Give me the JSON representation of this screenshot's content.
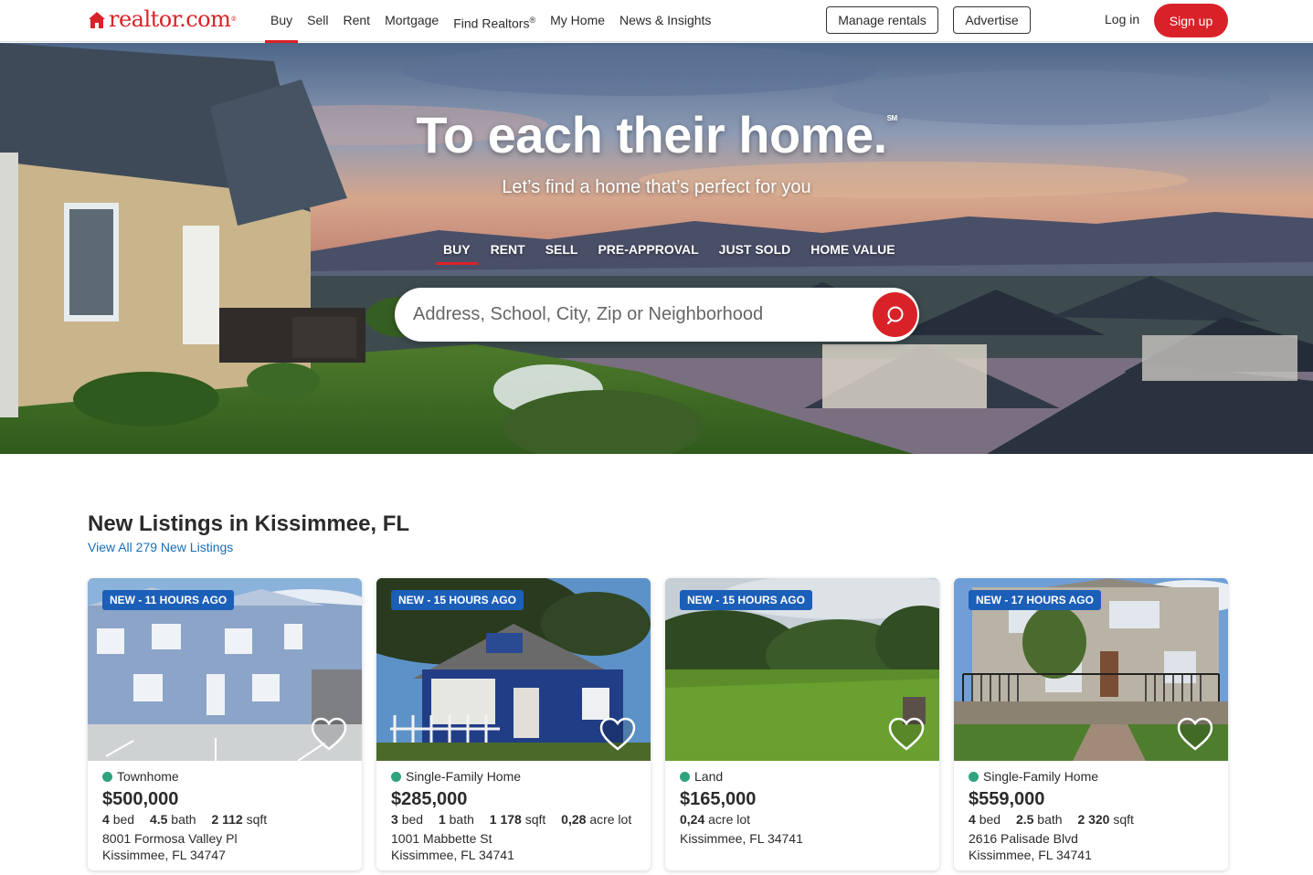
{
  "header": {
    "logo_text": "realtor.com",
    "logo_mark": "®",
    "nav": [
      {
        "label": "Buy",
        "active": true
      },
      {
        "label": "Sell"
      },
      {
        "label": "Rent"
      },
      {
        "label": "Mortgage"
      },
      {
        "label": "Find Realtors",
        "sup": "®"
      },
      {
        "label": "My Home"
      },
      {
        "label": "News & Insights"
      }
    ],
    "manage_rentals": "Manage rentals",
    "advertise": "Advertise",
    "login": "Log in",
    "signup": "Sign up"
  },
  "hero": {
    "title": "To each their home.",
    "title_mark": "SM",
    "subtitle": "Let’s find a home that’s perfect for you",
    "tabs": [
      "BUY",
      "RENT",
      "SELL",
      "PRE-APPROVAL",
      "JUST SOLD",
      "HOME VALUE"
    ],
    "active_tab": "BUY",
    "search_placeholder": "Address, School, City, Zip or Neighborhood"
  },
  "listings": {
    "title": "New Listings in Kissimmee, FL",
    "view_all": "View All 279 New Listings",
    "cards": [
      {
        "badge": "NEW - 11 HOURS AGO",
        "type": "Townhome",
        "price": "$500,000",
        "beds": "4",
        "beds_label": "bed",
        "baths": "4.5",
        "baths_label": "bath",
        "sqft": "2 112",
        "sqft_label": "sqft",
        "lot": "",
        "lot_label": "",
        "address1": "8001 Formosa Valley Pl",
        "address2": "Kissimmee, FL 34747"
      },
      {
        "badge": "NEW - 15 HOURS AGO",
        "type": "Single-Family Home",
        "price": "$285,000",
        "beds": "3",
        "beds_label": "bed",
        "baths": "1",
        "baths_label": "bath",
        "sqft": "1 178",
        "sqft_label": "sqft",
        "lot": "0,28",
        "lot_label": "acre lot",
        "address1": "1001 Mabbette St",
        "address2": "Kissimmee, FL 34741"
      },
      {
        "badge": "NEW - 15 HOURS AGO",
        "type": "Land",
        "price": "$165,000",
        "beds": "",
        "beds_label": "",
        "baths": "",
        "baths_label": "",
        "sqft": "",
        "sqft_label": "",
        "lot": "0,24",
        "lot_label": "acre lot",
        "address1": "Kissimmee, FL 34741",
        "address2": ""
      },
      {
        "badge": "NEW - 17 HOURS AGO",
        "type": "Single-Family Home",
        "price": "$559,000",
        "beds": "4",
        "beds_label": "bed",
        "baths": "2.5",
        "baths_label": "bath",
        "sqft": "2 320",
        "sqft_label": "sqft",
        "lot": "",
        "lot_label": "",
        "address1": "2616 Palisade Blvd",
        "address2": "Kissimmee, FL 34741"
      }
    ]
  },
  "icons": {
    "logo": "house-icon",
    "search": "search-icon",
    "favorite": "heart-icon",
    "status": "status-dot-icon"
  },
  "colors": {
    "brand_red": "#d92228",
    "badge_blue": "#1c5fb8",
    "status_green": "#2fa27e",
    "link_blue": "#1a6eb5"
  }
}
